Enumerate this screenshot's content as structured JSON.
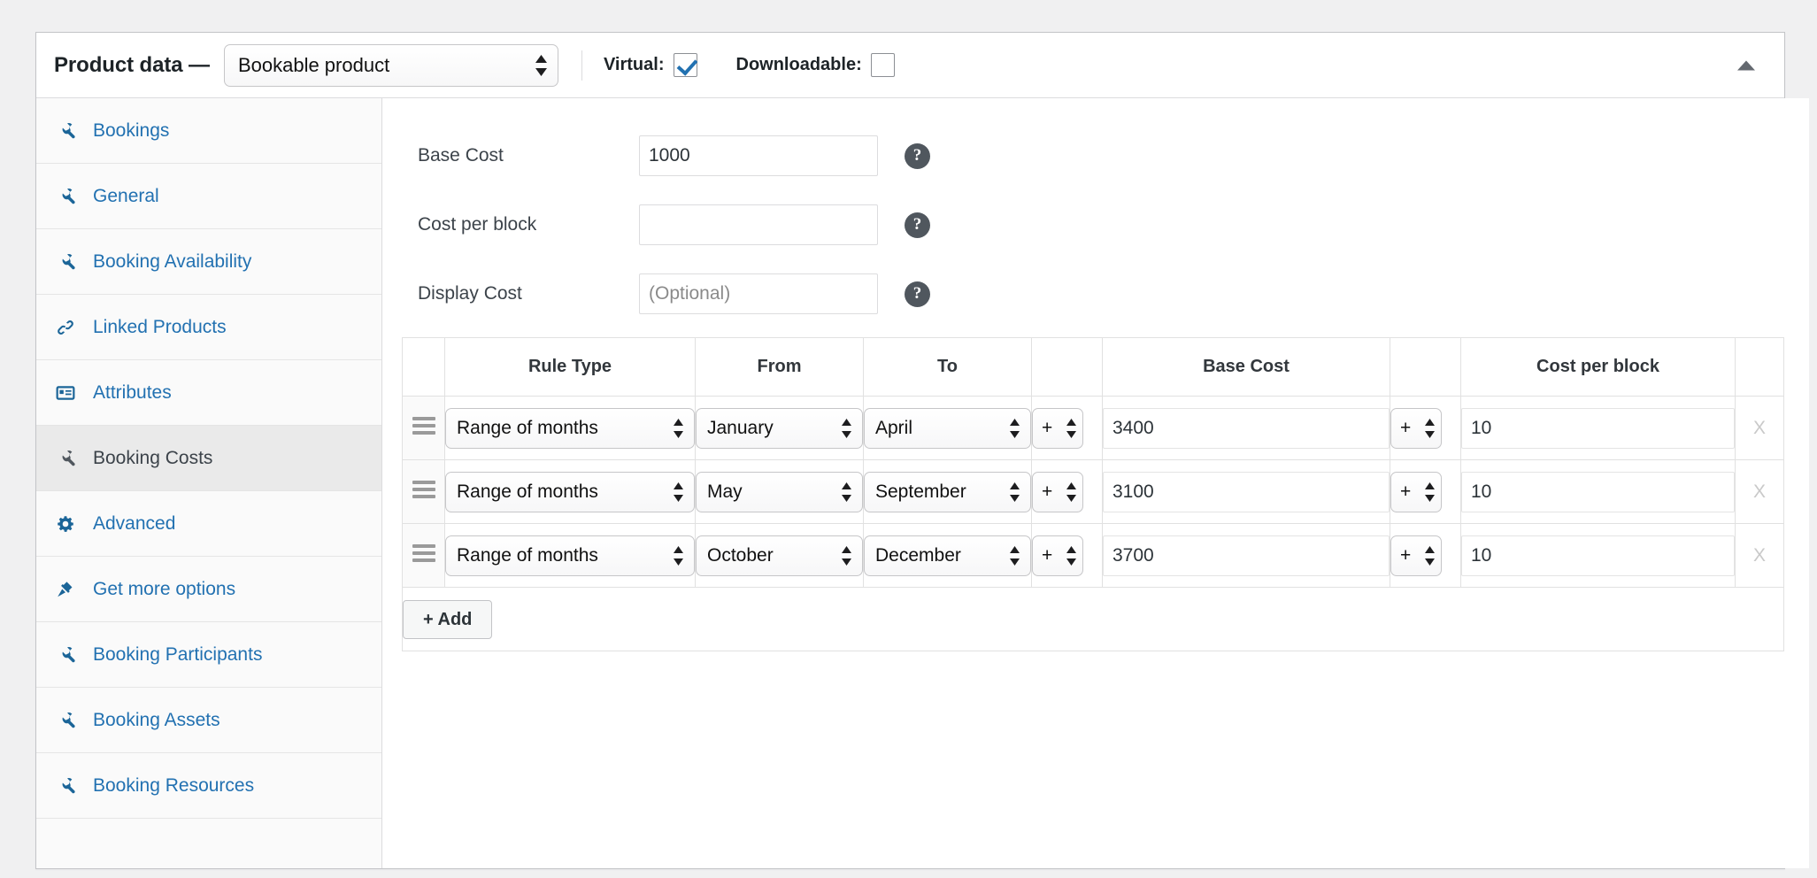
{
  "panel": {
    "title": "Product data —",
    "product_type": "Bookable product",
    "virtual_label": "Virtual:",
    "virtual_checked": true,
    "downloadable_label": "Downloadable:",
    "downloadable_checked": false,
    "collapse_icon": "triangle-up-icon",
    "accent_color": "#2271b1",
    "active_tab_bg": "#eaeaea"
  },
  "sidebar": {
    "items": [
      {
        "label": "Bookings",
        "icon": "wrench-icon",
        "active": false
      },
      {
        "label": "General",
        "icon": "wrench-icon",
        "active": false
      },
      {
        "label": "Booking Availability",
        "icon": "wrench-icon",
        "active": false
      },
      {
        "label": "Linked Products",
        "icon": "link-icon",
        "active": false
      },
      {
        "label": "Attributes",
        "icon": "list-icon",
        "active": false
      },
      {
        "label": "Booking Costs",
        "icon": "wrench-icon",
        "active": true
      },
      {
        "label": "Advanced",
        "icon": "gear-icon",
        "active": false
      },
      {
        "label": "Get more options",
        "icon": "plugin-icon",
        "active": false
      },
      {
        "label": "Booking Participants",
        "icon": "wrench-icon",
        "active": false
      },
      {
        "label": "Booking Assets",
        "icon": "wrench-icon",
        "active": false
      },
      {
        "label": "Booking Resources",
        "icon": "wrench-icon",
        "active": false
      }
    ]
  },
  "form": {
    "fields": [
      {
        "label": "Base Cost",
        "value": "1000",
        "placeholder": "",
        "help": "?"
      },
      {
        "label": "Cost per block",
        "value": "",
        "placeholder": "",
        "help": "?"
      },
      {
        "label": "Display Cost",
        "value": "",
        "placeholder": "(Optional)",
        "help": "?"
      }
    ]
  },
  "rules_table": {
    "headers": [
      "",
      "Rule Type",
      "From",
      "To",
      "",
      "Base Cost",
      "",
      "Cost per block",
      ""
    ],
    "rows": [
      {
        "handle": "drag-handle-icon",
        "rule_type": "Range of months",
        "from": "January",
        "to": "April",
        "base_cost_modifier": "+",
        "base_cost": "3400",
        "block_cost_modifier": "+",
        "cost_per_block": "10",
        "delete": "X"
      },
      {
        "handle": "drag-handle-icon",
        "rule_type": "Range of months",
        "from": "May",
        "to": "September",
        "base_cost_modifier": "+",
        "base_cost": "3100",
        "block_cost_modifier": "+",
        "cost_per_block": "10",
        "delete": "X"
      },
      {
        "handle": "drag-handle-icon",
        "rule_type": "Range of months",
        "from": "October",
        "to": "December",
        "base_cost_modifier": "+",
        "base_cost": "3700",
        "block_cost_modifier": "+",
        "cost_per_block": "10",
        "delete": "X"
      }
    ],
    "add_button": "+ Add"
  }
}
